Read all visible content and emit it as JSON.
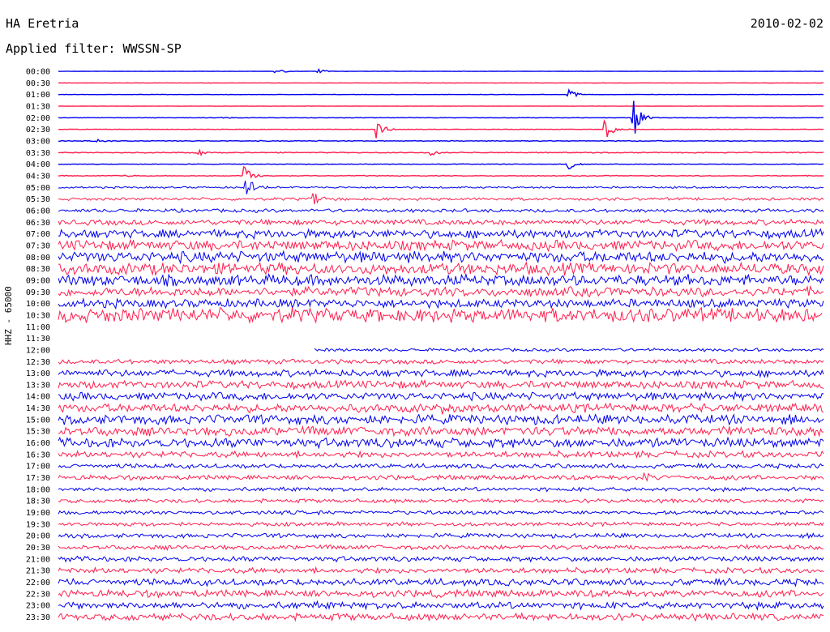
{
  "header": {
    "station": "HA Eretria",
    "date": "2010-02-02",
    "filter": "Applied filter: WWSSN-SP",
    "channel": "HHZ - 65000"
  },
  "colors": {
    "odd_trace": "#0000ee",
    "even_trace": "#ff1e4e",
    "background": "#ffffff"
  },
  "chart_data": {
    "type": "line",
    "title": "HA Eretria",
    "subtitle": "Applied filter: WWSSN-SP",
    "ylabel": "HHZ - 65000",
    "xlabel": "",
    "rows": [
      "00:00",
      "00:30",
      "01:00",
      "01:30",
      "02:00",
      "02:30",
      "03:00",
      "03:30",
      "04:00",
      "04:30",
      "05:00",
      "05:30",
      "06:00",
      "06:30",
      "07:00",
      "07:30",
      "08:00",
      "08:30",
      "09:00",
      "09:30",
      "10:00",
      "10:30",
      "11:00",
      "11:30",
      "12:00",
      "12:30",
      "13:00",
      "13:30",
      "14:00",
      "14:30",
      "15:00",
      "15:30",
      "16:00",
      "16:30",
      "17:00",
      "17:30",
      "18:00",
      "18:30",
      "19:00",
      "19:30",
      "20:00",
      "20:30",
      "21:00",
      "21:30",
      "22:00",
      "22:30",
      "23:00",
      "23:30"
    ],
    "row_minutes": 30,
    "noise_amplitude": [
      0.02,
      0.02,
      0.02,
      0.02,
      0.03,
      0.03,
      0.05,
      0.06,
      0.04,
      0.05,
      0.12,
      0.18,
      0.22,
      0.35,
      0.55,
      0.65,
      0.7,
      0.75,
      0.7,
      0.6,
      0.55,
      0.9,
      0,
      0,
      0.2,
      0.3,
      0.45,
      0.5,
      0.5,
      0.55,
      0.6,
      0.6,
      0.6,
      0.4,
      0.3,
      0.3,
      0.25,
      0.25,
      0.25,
      0.25,
      0.28,
      0.3,
      0.32,
      0.35,
      0.45,
      0.45,
      0.45,
      0.45
    ],
    "events": [
      {
        "row": 0,
        "minute": 8.5,
        "amplitude": 0.6
      },
      {
        "row": 0,
        "minute": 10.2,
        "amplitude": 0.4
      },
      {
        "row": 2,
        "minute": 20.0,
        "amplitude": 0.9
      },
      {
        "row": 4,
        "minute": 6.4,
        "amplitude": 0.3
      },
      {
        "row": 4,
        "minute": 22.5,
        "amplitude": 4.0
      },
      {
        "row": 5,
        "minute": 12.5,
        "amplitude": 1.6
      },
      {
        "row": 5,
        "minute": 21.4,
        "amplitude": 2.2
      },
      {
        "row": 6,
        "minute": 1.5,
        "amplitude": 0.5
      },
      {
        "row": 7,
        "minute": 5.5,
        "amplitude": 0.7
      },
      {
        "row": 7,
        "minute": 14.6,
        "amplitude": 0.8
      },
      {
        "row": 8,
        "minute": 20.0,
        "amplitude": 1.0
      },
      {
        "row": 9,
        "minute": 2.6,
        "amplitude": 0.3
      },
      {
        "row": 9,
        "minute": 7.3,
        "amplitude": 2.0
      },
      {
        "row": 10,
        "minute": 7.3,
        "amplitude": 2.4
      },
      {
        "row": 11,
        "minute": 10.0,
        "amplitude": 1.2
      },
      {
        "row": 29,
        "minute": 15.0,
        "amplitude": 0.8
      },
      {
        "row": 35,
        "minute": 23.0,
        "amplitude": 1.1
      },
      {
        "row": 38,
        "minute": 33.0,
        "amplitude": 0.6
      },
      {
        "row": 40,
        "minute": 33.0,
        "amplitude": 2.0
      }
    ],
    "gap": {
      "start": "11:00",
      "end": "12:10"
    },
    "grid": false,
    "legend": "none"
  }
}
